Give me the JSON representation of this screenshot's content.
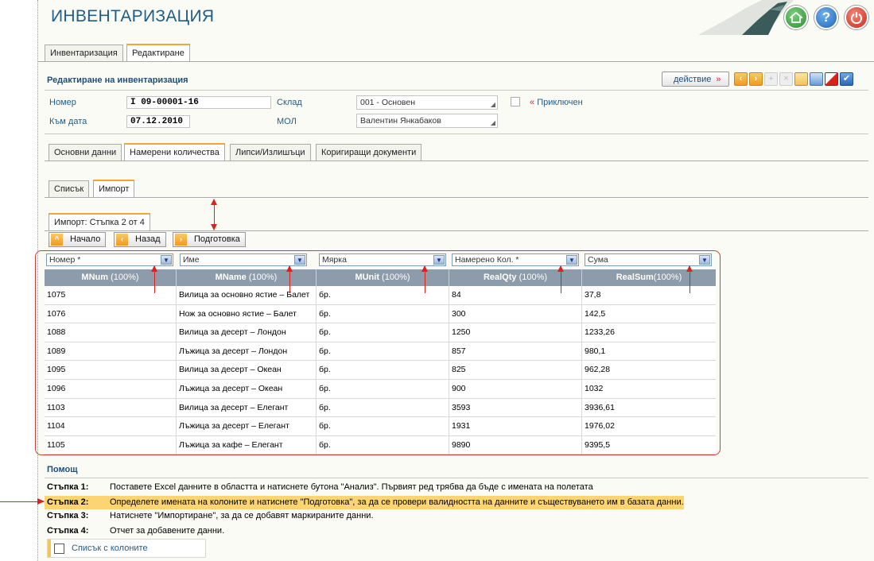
{
  "app": {
    "title": "ИНВЕНТАРИЗАЦИЯ"
  },
  "main_tabs": [
    "Инвентаризация",
    "Редактиране"
  ],
  "form": {
    "title": "Редактиране на инвентаризация",
    "action_label": "действие",
    "action_arrow": "»",
    "number_label": "Номер",
    "number_value": "I 09-00001-16",
    "date_label": "Към дата",
    "date_value": "07.12.2010",
    "warehouse_label": "Склад",
    "warehouse_value": "001 - Основен",
    "mol_label": "МОЛ",
    "mol_value": "Валентин Янкабаков",
    "closed_quote": "«",
    "closed_label": "Приключен"
  },
  "sub_tabs": [
    "Основни данни",
    "Намерени количества",
    "Липси/Излишъци",
    "Коригиращи документи"
  ],
  "view_tabs": [
    "Списък",
    "Импорт"
  ],
  "import": {
    "step_tab": "Импорт: Стъпка 2 от 4",
    "buttons": {
      "start": "Начало",
      "back": "Назад",
      "prepare": "Подготовка"
    },
    "column_selects": [
      "Номер *",
      "Име",
      "Мярка",
      "Намерено Кол. *",
      "Сума"
    ],
    "headers": [
      {
        "name": "MNum",
        "pct": " (100%)"
      },
      {
        "name": "MName",
        "pct": " (100%)"
      },
      {
        "name": "MUnit",
        "pct": " (100%)"
      },
      {
        "name": "RealQty",
        "pct": " (100%)"
      },
      {
        "name": "RealSum",
        "pct": "(100%)"
      }
    ],
    "rows": [
      [
        "1075",
        "Вилица за основно ястие – Балет",
        "бр.",
        "84",
        "37,8"
      ],
      [
        "1076",
        "Нож за основно ястие – Балет",
        "бр.",
        "300",
        "142,5"
      ],
      [
        "1088",
        "Вилица за десерт – Лондон",
        "бр.",
        "1250",
        "1233,26"
      ],
      [
        "1089",
        "Лъжица за десерт – Лондон",
        "бр.",
        "857",
        "980,1"
      ],
      [
        "1095",
        "Вилица за десерт – Океан",
        "бр.",
        "825",
        "962,28"
      ],
      [
        "1096",
        "Лъжица за десерт – Океан",
        "бр.",
        "900",
        "1032"
      ],
      [
        "1103",
        "Вилица за десерт – Елегант",
        "бр.",
        "3593",
        "3936,61"
      ],
      [
        "1104",
        "Лъжица за десерт – Елегант",
        "бр.",
        "1931",
        "1976,02"
      ],
      [
        "1105",
        "Лъжица за кафе – Елегант",
        "бр.",
        "9890",
        "9395,5"
      ]
    ]
  },
  "help": {
    "title": "Помощ",
    "steps": [
      {
        "key": "Стъпка 1:",
        "text": "Поставете Excel данните в областта и натиснете бутона \"Анализ\". Първият ред трябва да бъде с имената на полетата"
      },
      {
        "key": "Стъпка 2:",
        "text": "Определете имената на колоните и натиснете \"Подготовка\", за да се провери валидността на данните и съществуването им в базата данни."
      },
      {
        "key": "Стъпка 3:",
        "text": "Натиснете \"Импортиране\", за да се добавят маркираните данни."
      },
      {
        "key": "Стъпка 4:",
        "text": "Отчет за добавените данни."
      }
    ],
    "column_list_label": "Списък с колоните"
  },
  "icons": [
    "home-icon",
    "help-icon",
    "power-icon",
    "prev-icon",
    "next-icon",
    "add-icon",
    "delete-icon",
    "document-icon",
    "print-icon",
    "cancel-icon",
    "confirm-icon"
  ],
  "colors": {
    "accent": "#f0a830",
    "title": "#1f5c86",
    "grid_header": "#8d9caa",
    "highlight": "#fcd572",
    "annotation": "#e02020"
  }
}
